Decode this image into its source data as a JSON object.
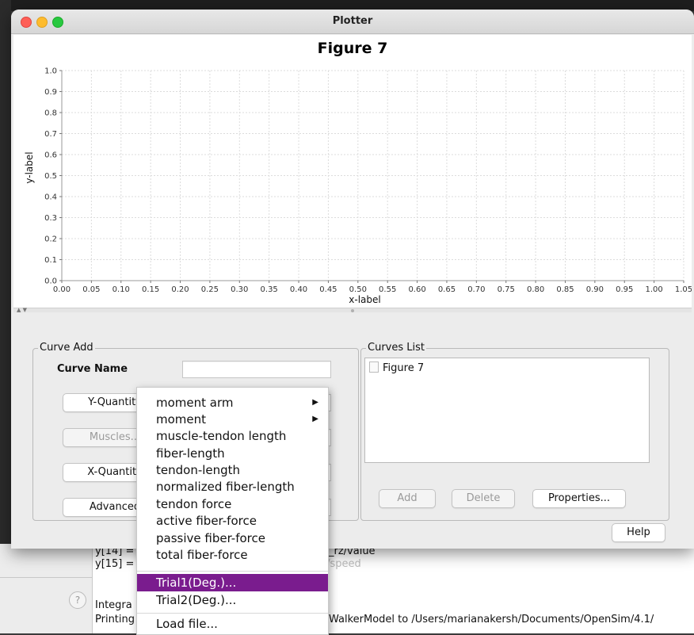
{
  "window": {
    "title": "Plotter"
  },
  "figure": {
    "title": "Figure 7",
    "xlabel": "x-label",
    "ylabel": "y-label"
  },
  "chart_data": {
    "type": "line",
    "title": "Figure 7",
    "xlabel": "x-label",
    "ylabel": "y-label",
    "xlim": [
      0.0,
      1.05
    ],
    "ylim": [
      0.0,
      1.0
    ],
    "x_ticks": [
      "0.00",
      "0.05",
      "0.10",
      "0.15",
      "0.20",
      "0.25",
      "0.30",
      "0.35",
      "0.40",
      "0.45",
      "0.50",
      "0.55",
      "0.60",
      "0.65",
      "0.70",
      "0.75",
      "0.80",
      "0.85",
      "0.90",
      "0.95",
      "1.00",
      "1.05"
    ],
    "y_ticks": [
      "0.0",
      "0.1",
      "0.2",
      "0.3",
      "0.4",
      "0.5",
      "0.6",
      "0.7",
      "0.8",
      "0.9",
      "1.0"
    ],
    "grid": true,
    "series": []
  },
  "curve_add": {
    "group_title": "Curve Add",
    "curve_name_label": "Curve Name",
    "curve_name_value": "",
    "y_quantity_button": "Y-Quantity",
    "muscles_button": "Muscles...",
    "x_quantity_button": "X-Quantity",
    "advanced_button": "Advanced"
  },
  "curves_list": {
    "group_title": "Curves List",
    "items": [
      "Figure 7"
    ],
    "add_button": "Add",
    "delete_button": "Delete",
    "properties_button": "Properties..."
  },
  "help_button": "Help",
  "menu": {
    "items": [
      {
        "label": "moment arm",
        "submenu": true
      },
      {
        "label": "moment",
        "submenu": true
      },
      {
        "label": "muscle-tendon length",
        "submenu": false
      },
      {
        "label": "fiber-length",
        "submenu": false
      },
      {
        "label": "tendon-length",
        "submenu": false
      },
      {
        "label": "normalized fiber-length",
        "submenu": false
      },
      {
        "label": "tendon force",
        "submenu": false
      },
      {
        "label": "active fiber-force",
        "submenu": false
      },
      {
        "label": "passive fiber-force",
        "submenu": false
      },
      {
        "label": "total fiber-force",
        "submenu": false
      }
    ],
    "trial_items": [
      "Trial1(Deg.)...",
      "Trial2(Deg.)..."
    ],
    "selected": "Trial1(Deg.)...",
    "load_file": "Load file...",
    "arrow_glyph": "▶"
  },
  "console": {
    "lines": [
      "y[14] =",
      "_rz/value",
      "y[15] =",
      "Thigh/Knee_rz/speed",
      "Integra",
      "Printing",
      "WalkerModel to /Users/marianakersh/Documents/OpenSim/4.1/"
    ],
    "help_glyph": "?"
  },
  "colors": {
    "menu_selected": "#7a1c8e",
    "grid": "#dcdcdc"
  }
}
